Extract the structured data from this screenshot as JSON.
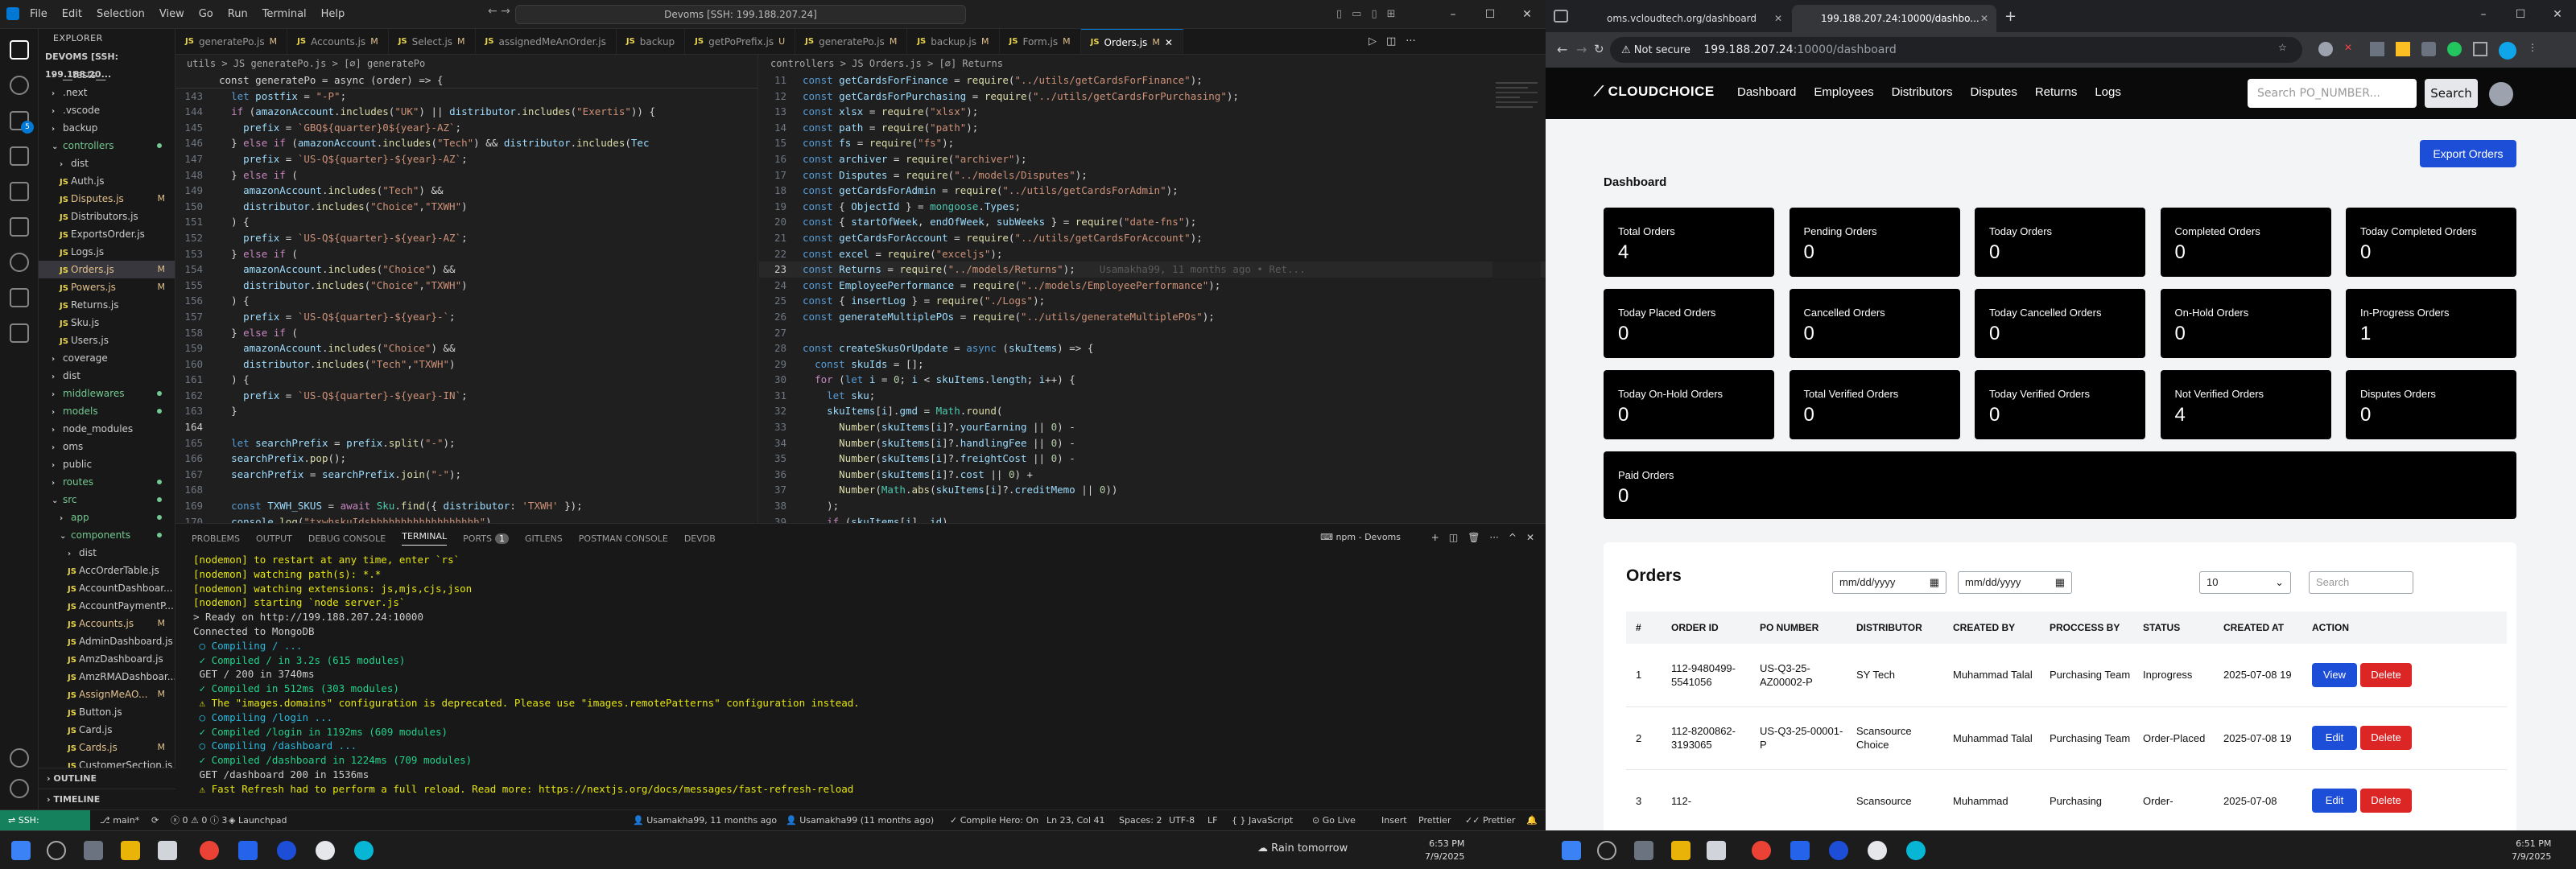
{
  "vscode": {
    "menu": [
      "File",
      "Edit",
      "Selection",
      "View",
      "Go",
      "Run",
      "Terminal",
      "Help"
    ],
    "search": "Devoms [SSH: 199.188.207.24]",
    "tabs": [
      {
        "label": "generatePo.js",
        "mark": "M",
        "active": false
      },
      {
        "label": "Accounts.js",
        "mark": "M",
        "active": false
      },
      {
        "label": "Select.js",
        "mark": "M",
        "active": false
      },
      {
        "label": "assignedMeAnOrder.js",
        "mark": "",
        "active": false
      },
      {
        "label": "backup",
        "mark": "",
        "active": false
      },
      {
        "label": "getPoPrefix.js",
        "mark": "U",
        "active": false
      },
      {
        "label": "generatePo.js",
        "mark": "M",
        "active": false
      },
      {
        "label": "backup.js",
        "mark": "M",
        "active": false
      },
      {
        "label": "Form.js",
        "mark": "M",
        "active": false
      },
      {
        "label": "Orders.js",
        "mark": "M",
        "active": true
      }
    ],
    "explorer": {
      "title": "EXPLORER",
      "root": "DEVOMS [SSH: 199.188.20...",
      "items": [
        {
          "label": "__tests__",
          "type": "folder",
          "indent": 1
        },
        {
          "label": ".next",
          "type": "folder",
          "indent": 1
        },
        {
          "label": ".vscode",
          "type": "folder",
          "indent": 1
        },
        {
          "label": "backup",
          "type": "folder",
          "indent": 1
        },
        {
          "label": "controllers",
          "type": "folder-open",
          "indent": 1,
          "mark": "dot"
        },
        {
          "label": "dist",
          "type": "folder",
          "indent": 2
        },
        {
          "label": "Auth.js",
          "type": "js",
          "indent": 2
        },
        {
          "label": "Disputes.js",
          "type": "js",
          "indent": 2,
          "mark": "M"
        },
        {
          "label": "Distributors.js",
          "type": "js",
          "indent": 2
        },
        {
          "label": "ExportsOrder.js",
          "type": "js",
          "indent": 2
        },
        {
          "label": "Logs.js",
          "type": "js",
          "indent": 2
        },
        {
          "label": "Orders.js",
          "type": "js",
          "indent": 2,
          "mark": "M",
          "selected": true
        },
        {
          "label": "Powers.js",
          "type": "js",
          "indent": 2,
          "mark": "M"
        },
        {
          "label": "Returns.js",
          "type": "js",
          "indent": 2
        },
        {
          "label": "Sku.js",
          "type": "js",
          "indent": 2
        },
        {
          "label": "Users.js",
          "type": "js",
          "indent": 2
        },
        {
          "label": "coverage",
          "type": "folder",
          "indent": 1
        },
        {
          "label": "dist",
          "type": "folder",
          "indent": 1
        },
        {
          "label": "middlewares",
          "type": "folder",
          "indent": 1,
          "mark": "dot"
        },
        {
          "label": "models",
          "type": "folder",
          "indent": 1,
          "mark": "dot"
        },
        {
          "label": "node_modules",
          "type": "folder",
          "indent": 1
        },
        {
          "label": "oms",
          "type": "folder",
          "indent": 1
        },
        {
          "label": "public",
          "type": "folder",
          "indent": 1
        },
        {
          "label": "routes",
          "type": "folder",
          "indent": 1,
          "mark": "dot"
        },
        {
          "label": "src",
          "type": "folder-open",
          "indent": 1,
          "mark": "dot"
        },
        {
          "label": "app",
          "type": "folder",
          "indent": 2,
          "mark": "dot"
        },
        {
          "label": "components",
          "type": "folder-open",
          "indent": 2,
          "mark": "dot"
        },
        {
          "label": "dist",
          "type": "folder",
          "indent": 3
        },
        {
          "label": "AccOrderTable.js",
          "type": "js",
          "indent": 3
        },
        {
          "label": "AccountDashboar...",
          "type": "js",
          "indent": 3
        },
        {
          "label": "AccountPaymentP...",
          "type": "js",
          "indent": 3
        },
        {
          "label": "Accounts.js",
          "type": "js",
          "indent": 3,
          "mark": "M"
        },
        {
          "label": "AdminDashboard.js",
          "type": "js",
          "indent": 3
        },
        {
          "label": "AmzDashboard.js",
          "type": "js",
          "indent": 3
        },
        {
          "label": "AmzRMADashboar...",
          "type": "js",
          "indent": 3
        },
        {
          "label": "AssignMeAO...",
          "type": "js",
          "indent": 3,
          "mark": "M"
        },
        {
          "label": "Button.js",
          "type": "js",
          "indent": 3
        },
        {
          "label": "Card.js",
          "type": "js",
          "indent": 3
        },
        {
          "label": "Cards.js",
          "type": "js",
          "indent": 3,
          "mark": "M"
        },
        {
          "label": "CustomerSection.js",
          "type": "js",
          "indent": 3
        }
      ],
      "outline": "OUTLINE",
      "timeline": "TIMELINE"
    },
    "left_editor": {
      "breadcrumb": "utils > JS generatePo.js > [∅] generatePo",
      "top_line": "const generatePo = async (order) => {",
      "lines": [
        {
          "n": "143",
          "t": "  let postfix = \"-P\";"
        },
        {
          "n": "144",
          "t": "  if (amazonAccount.includes(\"UK\") || distributor.includes(\"Exertis\")) {"
        },
        {
          "n": "145",
          "t": "    prefix = `GBQ${quarter}0${year}-AZ`;"
        },
        {
          "n": "146",
          "t": "  } else if (amazonAccount.includes(\"Tech\") && distributor.includes(\"Tec"
        },
        {
          "n": "147",
          "t": "    prefix = `US-Q${quarter}-${year}-AZ`;"
        },
        {
          "n": "148",
          "t": "  } else if ("
        },
        {
          "n": "149",
          "t": "    amazonAccount.includes(\"Tech\") &&"
        },
        {
          "n": "150",
          "t": "    distributor.includes(\"Choice\",\"TXWH\")"
        },
        {
          "n": "151",
          "t": "  ) {"
        },
        {
          "n": "152",
          "t": "    prefix = `US-Q${quarter}-${year}-AZ`;"
        },
        {
          "n": "153",
          "t": "  } else if ("
        },
        {
          "n": "154",
          "t": "    amazonAccount.includes(\"Choice\") &&"
        },
        {
          "n": "155",
          "t": "    distributor.includes(\"Choice\",\"TXWH\")"
        },
        {
          "n": "156",
          "t": "  ) {"
        },
        {
          "n": "157",
          "t": "    prefix = `US-Q${quarter}-${year}-`;"
        },
        {
          "n": "158",
          "t": "  } else if ("
        },
        {
          "n": "159",
          "t": "    amazonAccount.includes(\"Choice\") &&"
        },
        {
          "n": "160",
          "t": "    distributor.includes(\"Tech\",\"TXWH\")"
        },
        {
          "n": "161",
          "t": "  ) {"
        },
        {
          "n": "162",
          "t": "    prefix = `US-Q${quarter}-${year}-IN`;"
        },
        {
          "n": "163",
          "t": "  }"
        },
        {
          "n": "164",
          "t": ""
        },
        {
          "n": "165",
          "t": "  let searchPrefix = prefix.split(\"-\");"
        },
        {
          "n": "166",
          "t": "  searchPrefix.pop();"
        },
        {
          "n": "167",
          "t": "  searchPrefix = searchPrefix.join(\"-\");"
        },
        {
          "n": "168",
          "t": ""
        },
        {
          "n": "169",
          "t": "  const TXWH_SKUS = await Sku.find({ distributor: 'TXWH' });"
        },
        {
          "n": "170",
          "t": "  console.log(\"txwhskuIdshhhhhhhhhhhhhhhhhh\")"
        }
      ]
    },
    "right_editor": {
      "breadcrumb": "controllers > JS Orders.js > [∅] Returns",
      "lines": [
        {
          "n": "11",
          "t": "const getCardsForFinance = require(\"../utils/getCardsForFinance\");"
        },
        {
          "n": "12",
          "t": "const getCardsForPurchasing = require(\"../utils/getCardsForPurchasing\");"
        },
        {
          "n": "13",
          "t": "const xlsx = require(\"xlsx\");"
        },
        {
          "n": "14",
          "t": "const path = require(\"path\");"
        },
        {
          "n": "15",
          "t": "const fs = require(\"fs\");"
        },
        {
          "n": "16",
          "t": "const archiver = require(\"archiver\");"
        },
        {
          "n": "17",
          "t": "const Disputes = require(\"../models/Disputes\");"
        },
        {
          "n": "18",
          "t": "const getCardsForAdmin = require(\"../utils/getCardsForAdmin\");"
        },
        {
          "n": "19",
          "t": "const { ObjectId } = mongoose.Types;"
        },
        {
          "n": "20",
          "t": "const { startOfWeek, endOfWeek, subWeeks } = require(\"date-fns\");"
        },
        {
          "n": "21",
          "t": "const getCardsForAccount = require(\"../utils/getCardsForAccount\");"
        },
        {
          "n": "22",
          "t": "const excel = require(\"exceljs\");"
        },
        {
          "n": "23",
          "t": "const Returns = require(\"../models/Returns\");"
        },
        {
          "n": "24",
          "t": "const EmployeePerformance = require(\"../models/EmployeePerformance\");"
        },
        {
          "n": "25",
          "t": "const { insertLog } = require(\"./Logs\");"
        },
        {
          "n": "26",
          "t": "const generateMultiplePOs = require(\"../utils/generateMultiplePOs\");"
        },
        {
          "n": "27",
          "t": ""
        },
        {
          "n": "28",
          "t": "const createSkusOrUpdate = async (skuItems) => {"
        },
        {
          "n": "29",
          "t": "  const skuIds = [];"
        },
        {
          "n": "30",
          "t": "  for (let i = 0; i < skuItems.length; i++) {"
        },
        {
          "n": "31",
          "t": "    let sku;"
        },
        {
          "n": "32",
          "t": "    skuItems[i].gmd = Math.round("
        },
        {
          "n": "33",
          "t": "      Number(skuItems[i]?.yourEarning || 0) -"
        },
        {
          "n": "34",
          "t": "      Number(skuItems[i]?.handlingFee || 0) -"
        },
        {
          "n": "35",
          "t": "      Number(skuItems[i]?.freightCost || 0) -"
        },
        {
          "n": "36",
          "t": "      Number(skuItems[i]?.cost || 0) +"
        },
        {
          "n": "37",
          "t": "      Number(Math.abs(skuItems[i]?.creditMemo || 0))"
        },
        {
          "n": "38",
          "t": "    );"
        },
        {
          "n": "39",
          "t": "    if (skuItems[i]._id)"
        }
      ],
      "blame": "Usamakha99, 11 months ago • Ret..."
    },
    "panel": {
      "tabs": [
        "PROBLEMS",
        "OUTPUT",
        "DEBUG CONSOLE",
        "TERMINAL",
        "PORTS",
        "GITLENS",
        "POSTMAN CONSOLE",
        "DEVDB"
      ],
      "ports_badge": "1",
      "terminal_name": "npm - Devoms",
      "lines": [
        "[nodemon] to restart at any time, enter `rs`",
        "[nodemon] watching path(s): *.*",
        "[nodemon] watching extensions: js,mjs,cjs,json",
        "[nodemon] starting `node server.js`",
        "> Ready on http://199.188.207.24:10000",
        "Connected to MongoDB",
        " ○ Compiling / ...",
        " ✓ Compiled / in 3.2s (615 modules)",
        " GET / 200 in 3740ms",
        " ✓ Compiled in 512ms (303 modules)",
        " ⚠ The \"images.domains\" configuration is deprecated. Please use \"images.remotePatterns\" configuration instead.",
        " ○ Compiling /login ...",
        " ✓ Compiled /login in 1192ms (609 modules)",
        " ○ Compiling /dashboard ...",
        " ✓ Compiled /dashboard in 1224ms (709 modules)",
        " GET /dashboard 200 in 1536ms",
        " ⚠ Fast Refresh had to perform a full reload. Read more: https://nextjs.org/docs/messages/fast-refresh-reload"
      ]
    },
    "status": {
      "remote": "SSH: 199.188.207.24",
      "branch": "main*",
      "errors": "0",
      "warnings": "0",
      "info": "3",
      "launchpad": "Launchpad",
      "blame_left": "Usamakha99, 11 months ago",
      "blame_right": "Usamakha99 (11 months ago)",
      "compile": "Compile Hero: On",
      "position": "Ln 23, Col 41",
      "spaces": "Spaces: 2",
      "encoding": "UTF-8",
      "eol": "LF",
      "lang": "JavaScript",
      "golive": "Go Live",
      "insert": "Insert",
      "prettier1": "Prettier",
      "prettier2": "Prettier"
    },
    "taskbar": {
      "weather": "Rain tomorrow",
      "time": "6:53 PM",
      "date": "7/9/2025"
    }
  },
  "chrome": {
    "tabs": [
      {
        "label": "oms.vcloudtech.org/dashboard",
        "active": false
      },
      {
        "label": "199.188.207.24:10000/dashbo...",
        "active": true
      }
    ],
    "omnibox": {
      "security": "Not secure",
      "host": "199.188.207.24",
      "rest": ":10000/dashboard"
    },
    "nav": {
      "logo": "CLOUDCHOICE",
      "links": [
        "Dashboard",
        "Employees",
        "Distributors",
        "Disputes",
        "Returns",
        "Logs"
      ],
      "search_placeholder": "Search PO_NUMBER...",
      "search_button": "Search"
    },
    "dashboard_title": "Dashboard",
    "export_button": "Export Orders",
    "cards": [
      {
        "label": "Total Orders",
        "value": "4"
      },
      {
        "label": "Pending Orders",
        "value": "0"
      },
      {
        "label": "Today Orders",
        "value": "0"
      },
      {
        "label": "Completed Orders",
        "value": "0"
      },
      {
        "label": "Today Completed Orders",
        "value": "0"
      },
      {
        "label": "Today Placed Orders",
        "value": "0"
      },
      {
        "label": "Cancelled Orders",
        "value": "0"
      },
      {
        "label": "Today Cancelled Orders",
        "value": "0"
      },
      {
        "label": "On-Hold Orders",
        "value": "0"
      },
      {
        "label": "In-Progress Orders",
        "value": "1"
      },
      {
        "label": "Today On-Hold Orders",
        "value": "0"
      },
      {
        "label": "Total Verified Orders",
        "value": "0"
      },
      {
        "label": "Today Verified Orders",
        "value": "0"
      },
      {
        "label": "Not Verified Orders",
        "value": "4"
      },
      {
        "label": "Disputes Orders",
        "value": "0"
      },
      {
        "label": "Paid Orders",
        "value": "0"
      }
    ],
    "orders": {
      "title": "Orders",
      "date_placeholder": "mm/dd/yyyy",
      "page_size": "10",
      "search_placeholder": "Search",
      "columns": [
        "#",
        "ORDER ID",
        "PO NUMBER",
        "DISTRIBUTOR",
        "CREATED BY",
        "PROCCESS BY",
        "STATUS",
        "CREATED AT",
        "ACTION"
      ],
      "rows": [
        {
          "num": "1",
          "order_id": "112-9480499-5541056",
          "po": "US-Q3-25-AZ00002-P",
          "distributor": "SY Tech",
          "created_by": "Muhammad Talal",
          "process_by": "Purchasing Team",
          "status": "Inprogress",
          "created_at": "2025-07-08 19",
          "action1": "View",
          "action2": "Delete"
        },
        {
          "num": "2",
          "order_id": "112-8200862-3193065",
          "po": "US-Q3-25-00001-P",
          "distributor": "Scansource Choice",
          "created_by": "Muhammad Talal",
          "process_by": "Purchasing Team",
          "status": "Order-Placed",
          "created_at": "2025-07-08 19",
          "action1": "Edit",
          "action2": "Delete"
        },
        {
          "num": "3",
          "order_id": "112-",
          "po": "",
          "distributor": "Scansource",
          "created_by": "Muhammad",
          "process_by": "Purchasing",
          "status": "Order-",
          "created_at": "2025-07-08",
          "action1": "Edit",
          "action2": "Delete"
        }
      ]
    },
    "taskbar": {
      "time": "6:51 PM",
      "date": "7/9/2025"
    }
  }
}
